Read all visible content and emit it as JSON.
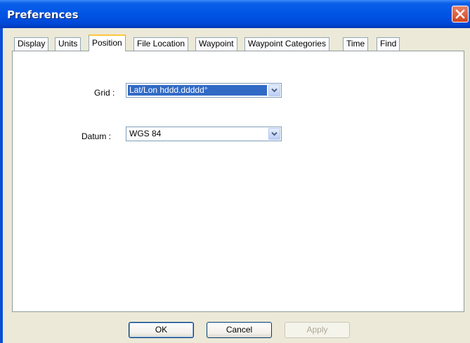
{
  "window": {
    "title": "Preferences"
  },
  "tabs": [
    {
      "label": "Display"
    },
    {
      "label": "Units"
    },
    {
      "label": "Position",
      "active": true
    },
    {
      "label": "File Location"
    },
    {
      "label": "Waypoint"
    },
    {
      "label": "Waypoint Categories"
    },
    {
      "label": "Time"
    },
    {
      "label": "Find"
    }
  ],
  "position": {
    "grid_label": "Grid :",
    "grid_value": "Lat/Lon hddd.ddddd°",
    "datum_label": "Datum :",
    "datum_value": "WGS 84"
  },
  "buttons": {
    "ok": "OK",
    "cancel": "Cancel",
    "apply": "Apply"
  },
  "colors": {
    "titlebar": "#0055e5",
    "selection": "#316ac5",
    "active_tab_accent": "#ffc83c"
  },
  "icons": {
    "close": "close-icon",
    "combo_arrow": "chevron-down-icon"
  }
}
